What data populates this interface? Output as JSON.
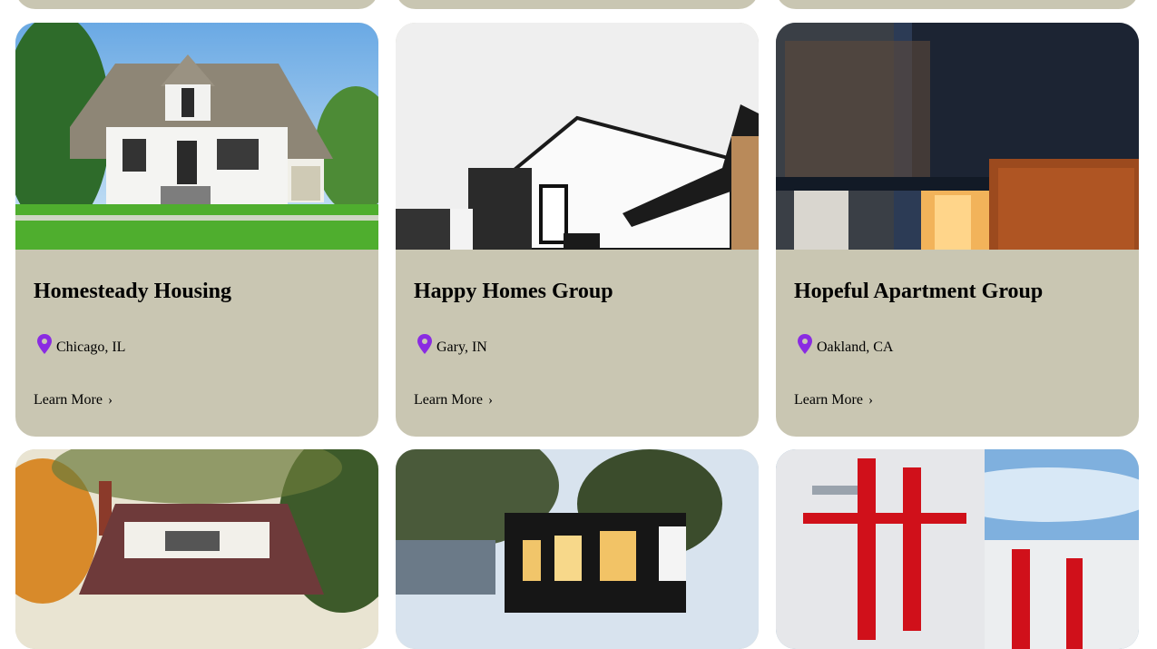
{
  "colors": {
    "card_bg": "#c9c6b2",
    "pin": "#8a2be2",
    "text": "#000000"
  },
  "cards": [
    {
      "title": "Homesteady Housing",
      "location": "Chicago, IL",
      "cta": "Learn More",
      "chevron": "›",
      "icon": "location-pin-icon"
    },
    {
      "title": "Happy Homes Group",
      "location": "Gary, IN",
      "cta": "Learn More",
      "chevron": "›",
      "icon": "location-pin-icon"
    },
    {
      "title": "Hopeful Apartment Group",
      "location": "Oakland, CA",
      "cta": "Learn More",
      "chevron": "›",
      "icon": "location-pin-icon"
    }
  ]
}
